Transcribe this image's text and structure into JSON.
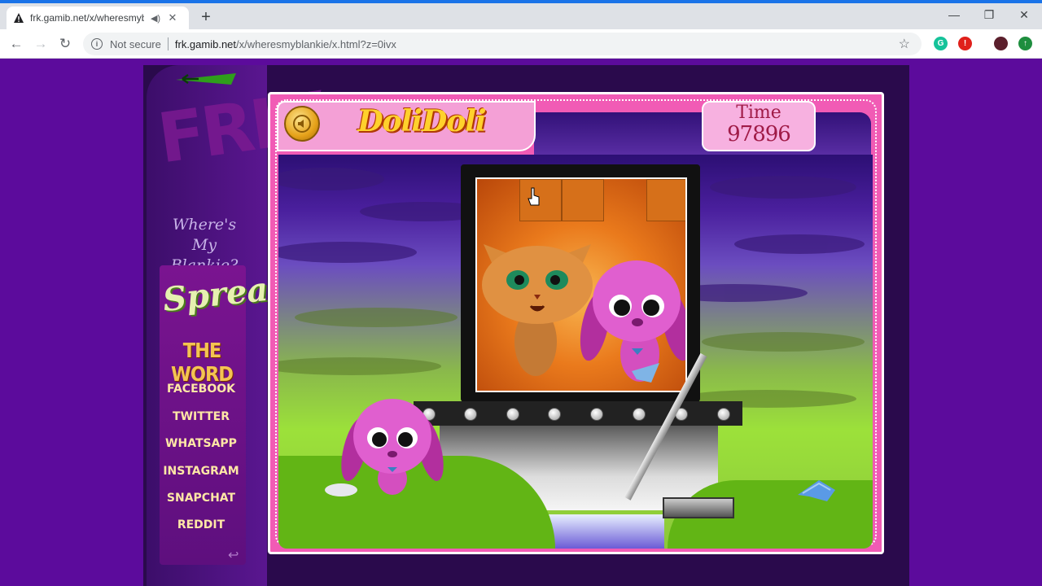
{
  "browser": {
    "tab_title": "frk.gamib.net/x/wheresmybla",
    "tab_audio_icon": "speaker-icon",
    "new_tab_label": "+",
    "omnibox": {
      "security_label": "Not secure",
      "url_host": "frk.gamib.net",
      "url_path": "/x/wheresmyblankie/x.html?z=0ivx"
    },
    "window_controls": [
      "minimize-icon",
      "restore-icon",
      "close-icon"
    ],
    "extensions": [
      {
        "name": "grammarly-extension-icon",
        "glyph": "G",
        "color": "#15c39a"
      },
      {
        "name": "adblock-extension-icon",
        "glyph": "!",
        "color": "#e0201b"
      },
      {
        "name": "profile-avatar",
        "glyph": "",
        "color": "#5b1f2c"
      },
      {
        "name": "update-extension-icon",
        "glyph": "↑",
        "color": "#1e8e3e"
      }
    ]
  },
  "sidebar": {
    "game_name_line1": "Where's",
    "game_name_line2": "My Blankie?",
    "spread_title": "Spread",
    "spread_subtitle": "THE WORD",
    "social_links": [
      "FACEBOOK",
      "TWITTER",
      "WHATSAPP",
      "INSTAGRAM",
      "SNAPCHAT",
      "REDDIT"
    ]
  },
  "game": {
    "logo": "DoliDoli",
    "time_label": "Time",
    "time_value": "97896"
  },
  "colors": {
    "brand_purple": "#5c0b9c",
    "frame_pink": "#f15bb5",
    "logo_gold": "#ffd12c"
  }
}
